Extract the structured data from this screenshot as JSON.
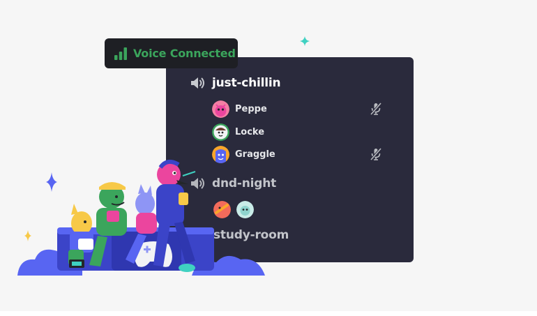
{
  "badge": {
    "label": "Voice Connected",
    "color": "#3ba55c",
    "icon": "signal-bars-icon"
  },
  "channels": [
    {
      "name": "just-chillin",
      "active": true,
      "members": [
        {
          "name": "Peppe",
          "muted": true
        },
        {
          "name": "Locke",
          "muted": false
        },
        {
          "name": "Graggle",
          "muted": true
        }
      ]
    },
    {
      "name": "dnd-night",
      "active": false,
      "avatar_count": 2
    },
    {
      "name": "study-room",
      "active": false
    }
  ],
  "colors": {
    "panel_bg": "#2a2a3c",
    "badge_bg": "#1e1f24",
    "page_bg": "#f6f6f6",
    "blurple": "#5865f2"
  }
}
